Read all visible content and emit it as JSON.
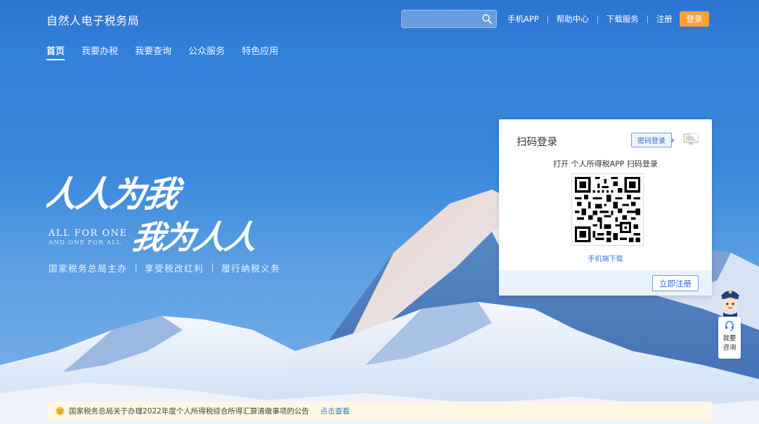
{
  "header": {
    "site_title": "自然人电子税务局",
    "search": {
      "placeholder": "",
      "value": ""
    },
    "links": [
      "手机APP",
      "帮助中心",
      "下载服务",
      "注册"
    ],
    "login_label": "登录"
  },
  "nav": {
    "tabs": [
      "首页",
      "我要办税",
      "我要查询",
      "公众服务",
      "特色应用"
    ],
    "active_index": 0
  },
  "hero": {
    "calligraphy_line1": "人人为我",
    "calligraphy_line2": "我为人人",
    "slogan_en_1": "ALL FOR ONE",
    "slogan_en_2": "AND ONE FOR ALL",
    "slogan_cn": [
      "国家税务总局主办",
      "享受税改红利",
      "履行纳税义务"
    ]
  },
  "login_card": {
    "title": "扫码登录",
    "password_login_label": "密码登录",
    "scan_hint": "打开 个人所得税APP 扫码登录",
    "download_label": "手机端下载",
    "register_label": "立即注册"
  },
  "consult": {
    "line1": "我要",
    "line2": "咨询"
  },
  "notice": {
    "text": "国家税务总局关于办理2022年度个人所得税综合所得汇算清缴事项的公告",
    "link": "点击查看"
  },
  "colors": {
    "accent_orange": "#f7a13a",
    "link_blue": "#3a7bd5",
    "header_blue": "#2c74d2",
    "notice_bg": "#fdf7e4"
  },
  "icons": {
    "search": "search-icon",
    "pc_toggle": "computer-icon",
    "headset": "headset-icon",
    "notice": "smile-icon"
  }
}
